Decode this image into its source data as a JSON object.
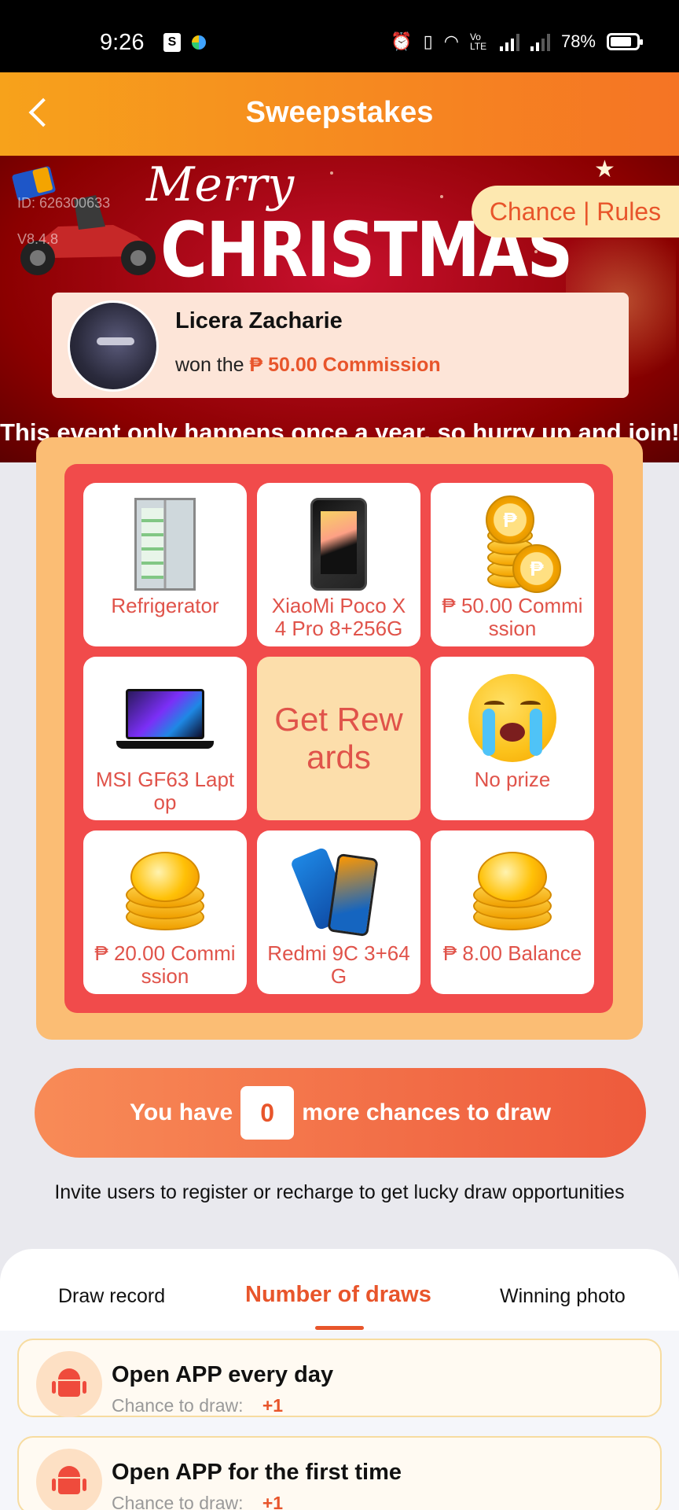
{
  "status_bar": {
    "time": "9:26",
    "battery": "78%",
    "net_label": "Vo LTE"
  },
  "header": {
    "title": "Sweepstakes"
  },
  "banner": {
    "merry": "Merry",
    "christmas": "CHRISTMAS",
    "id_text": "ID: 626300633",
    "version_text": "V8.4.8",
    "slogan": "This event only happens once a year, so hurry up and join!"
  },
  "chance_rules": "Chance | Rules",
  "winner": {
    "name": "Licera Zacharie",
    "prefix": "won the",
    "prize": "₱ 50.00 Commission"
  },
  "prizes": [
    {
      "label": "Refrigerator",
      "icon": "refrigerator-image"
    },
    {
      "label": "XiaoMi Poco X4 Pro 8+256G",
      "icon": "phone-image"
    },
    {
      "label": "₱ 50.00 Commission",
      "icon": "coins-image"
    },
    {
      "label": "MSI GF63 Laptop",
      "icon": "laptop-image"
    },
    {
      "label": "Get Rewards",
      "icon": ""
    },
    {
      "label": "No prize",
      "icon": "crying-emoji"
    },
    {
      "label": "₱ 20.00 Commission",
      "icon": "gold-coins-image"
    },
    {
      "label": "Redmi 9C 3+64G",
      "icon": "redmi-phone-image"
    },
    {
      "label": "₱ 8.00 Balance",
      "icon": "gold-coins-image"
    }
  ],
  "chances": {
    "prefix": "You have",
    "count": "0",
    "suffix": "more chances to draw"
  },
  "invite_text": "Invite users to register or recharge to get lucky draw opportunities",
  "tabs": [
    {
      "label": "Draw record",
      "active": false
    },
    {
      "label": "Number of draws",
      "active": true
    },
    {
      "label": "Winning photo",
      "active": false
    }
  ],
  "tasks": [
    {
      "title": "Open APP every day",
      "sub_label": "Chance to draw:",
      "bonus": "+1",
      "icon": "android-icon"
    },
    {
      "title": "Open APP for the first time",
      "sub_label": "Chance to draw:",
      "bonus": "+1",
      "icon": "android-icon"
    }
  ],
  "colors": {
    "accent": "#e8552b",
    "header_start": "#f7a21b",
    "header_end": "#f57424",
    "grid_red": "#f14b4b",
    "grid_frame": "#fbbd74"
  }
}
